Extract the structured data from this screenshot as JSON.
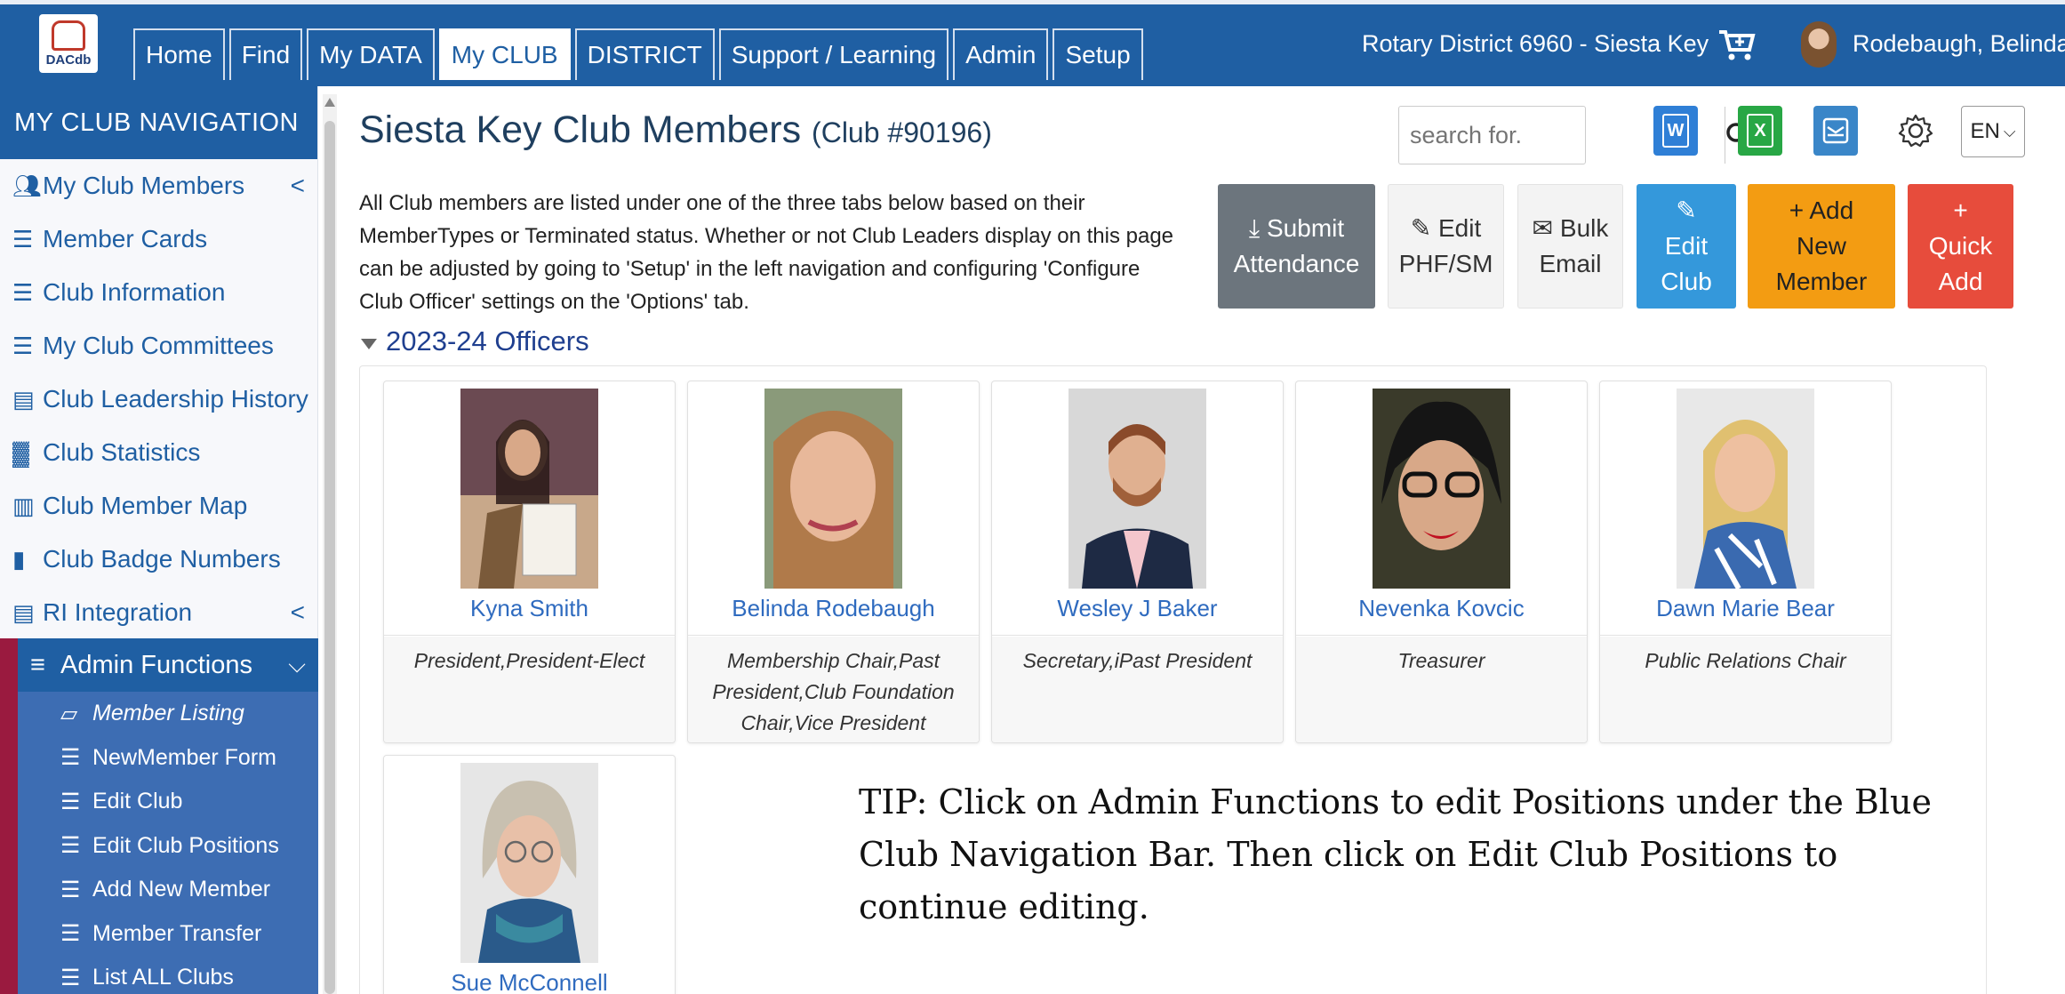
{
  "colors": {
    "primary": "#1f5fa3",
    "admin_accent": "#9a1a3f",
    "link": "#2f6bbf"
  },
  "brand": {
    "logo_text": "DACdb"
  },
  "topnav": {
    "tabs": [
      "Home",
      "Find",
      "My DATA",
      "My CLUB",
      "DISTRICT",
      "Support / Learning",
      "Admin",
      "Setup"
    ],
    "active_tab": "My CLUB",
    "district": "Rotary District 6960 - Siesta Key",
    "cart_icon": "cart-icon",
    "user_name": "Rodebaugh, Belinda"
  },
  "sidebar": {
    "title": "MY CLUB NAVIGATION",
    "items": [
      {
        "label": "My Club Members",
        "icon": "members-icon",
        "chevron": "<"
      },
      {
        "label": "Member Cards",
        "icon": "list-icon"
      },
      {
        "label": "Club Information",
        "icon": "list-icon"
      },
      {
        "label": "My Club Committees",
        "icon": "list-icon"
      },
      {
        "label": "Club Leadership History",
        "icon": "archive-icon"
      },
      {
        "label": "Club Statistics",
        "icon": "chart-icon"
      },
      {
        "label": "Club Member Map",
        "icon": "map-icon"
      },
      {
        "label": "Club Badge Numbers",
        "icon": "badge-icon"
      },
      {
        "label": "RI Integration",
        "icon": "list-box-icon",
        "chevron": "<"
      }
    ],
    "admin": {
      "label": "Admin Functions",
      "chevron": "v",
      "items": [
        {
          "label": "Member Listing",
          "icon": "square-icon"
        },
        {
          "label": "NewMember Form",
          "icon": "list-icon"
        },
        {
          "label": "Edit Club",
          "icon": "list-icon"
        },
        {
          "label": "Edit Club Positions",
          "icon": "list-icon"
        },
        {
          "label": "Add New Member",
          "icon": "list-icon"
        },
        {
          "label": "Member Transfer",
          "icon": "list-icon"
        },
        {
          "label": "List ALL Clubs",
          "icon": "list-icon"
        }
      ]
    }
  },
  "main": {
    "title": "Siesta Key Club Members",
    "club_number": "(Club #90196)",
    "intro": "All Club members are listed under one of the three tabs below based on their MemberTypes or Terminated status. Whether or not Club Leaders display on this page can be adjusted by going to 'Setup' in the left navigation and configuring 'Configure Club Officer' settings on the 'Options' tab.",
    "search_placeholder": "search for.",
    "export": {
      "word": "W",
      "excel": "X",
      "email_icon": "envelope-icon"
    },
    "language": "EN",
    "actions": [
      {
        "icon": "⤓",
        "line1": "Submit",
        "line2": "Attendance"
      },
      {
        "icon": "✎",
        "line1": "Edit",
        "line2": "PHF/SM"
      },
      {
        "icon": "✉",
        "line1": "Bulk",
        "line2": "Email"
      },
      {
        "icon": "✎",
        "line1": "Edit",
        "line2": "Club"
      },
      {
        "icon": "+",
        "line1": "Add",
        "line2": "New",
        "line3": "Member"
      },
      {
        "icon": "+",
        "line1": "Quick",
        "line2": "Add"
      }
    ],
    "section_title": "2023-24 Officers",
    "officers": [
      {
        "name": "Kyna Smith",
        "role": "President,President-Elect"
      },
      {
        "name": "Belinda Rodebaugh",
        "role": "Membership Chair,Past President,Club Foundation Chair,Vice President"
      },
      {
        "name": "Wesley J Baker",
        "role": "Secretary,iPast President"
      },
      {
        "name": "Nevenka Kovcic",
        "role": "Treasurer"
      },
      {
        "name": "Dawn Marie Bear",
        "role": "Public Relations Chair"
      },
      {
        "name": "Sue McConnell",
        "role": ""
      }
    ],
    "tip": "TIP: Click on Admin Functions to edit Positions under the Blue Club Navigation Bar. Then click on Edit Club Positions to continue editing."
  }
}
